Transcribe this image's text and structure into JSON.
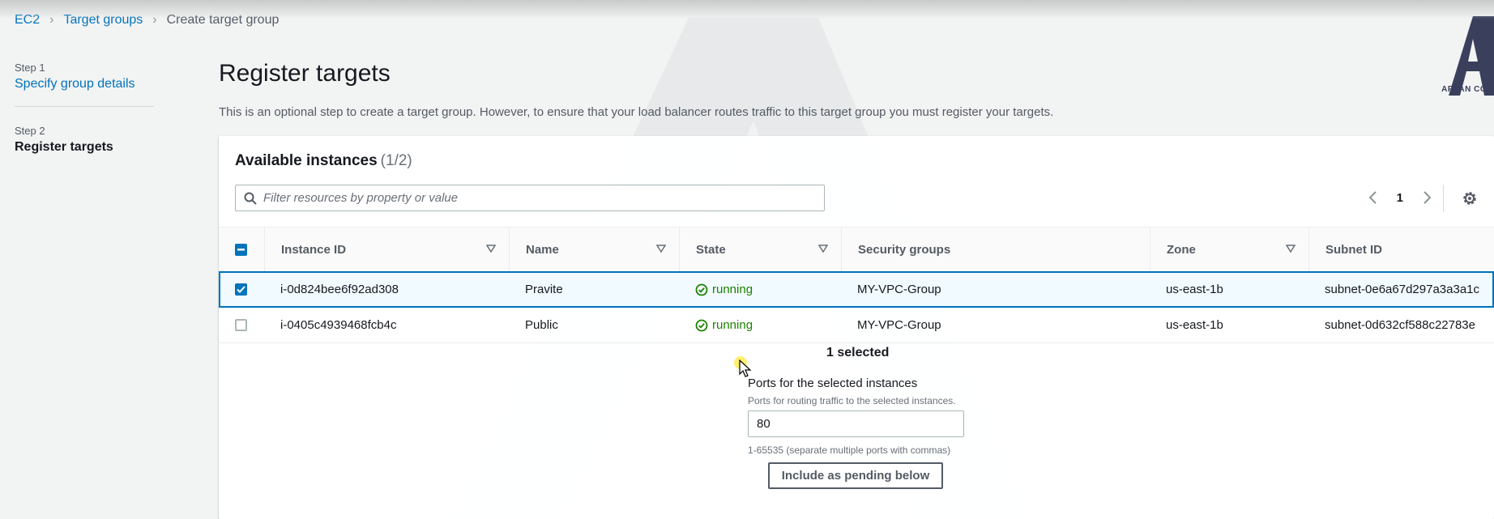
{
  "breadcrumb": {
    "items": [
      "EC2",
      "Target groups",
      "Create target group"
    ]
  },
  "steps": [
    {
      "number": "Step 1",
      "title": "Specify group details"
    },
    {
      "number": "Step 2",
      "title": "Register targets"
    }
  ],
  "page": {
    "title": "Register targets",
    "description": "This is an optional step to create a target group. However, to ensure that your load balancer routes traffic to this target group you must register your targets."
  },
  "instances_panel": {
    "heading": "Available instances",
    "count": "(1/2)",
    "search_placeholder": "Filter resources by property or value",
    "current_page": "1",
    "columns": [
      "Instance ID",
      "Name",
      "State",
      "Security groups",
      "Zone",
      "Subnet ID"
    ],
    "rows": [
      {
        "selected": true,
        "instance_id": "i-0d824bee6f92ad308",
        "name": "Pravite",
        "state": "running",
        "security_group": "MY-VPC-Group",
        "zone": "us-east-1b",
        "subnet_id": "subnet-0e6a67d297a3a3a1c"
      },
      {
        "selected": false,
        "instance_id": "i-0405c4939468fcb4c",
        "name": "Public",
        "state": "running",
        "security_group": "MY-VPC-Group",
        "zone": "us-east-1b",
        "subnet_id": "subnet-0d632cf588c22783e"
      }
    ]
  },
  "selection": {
    "count_text": "1 selected",
    "ports_label": "Ports for the selected instances",
    "ports_description": "Ports for routing traffic to the selected instances.",
    "ports_value": "80",
    "ports_hint": "1-65535 (separate multiple ports with commas)",
    "include_button": "Include as pending below"
  },
  "logo": {
    "text": "ARYAN COM"
  },
  "colors": {
    "link": "#0073bb",
    "running": "#1d8102",
    "selected_border": "#0073bb",
    "background": "#f2f3f3"
  },
  "icons": {
    "search": "search-icon",
    "settings": "gear-icon",
    "sort": "sort-triangle-icon",
    "status": "check-circle-icon",
    "pager_prev": "chevron-left-icon",
    "pager_next": "chevron-right-icon"
  }
}
